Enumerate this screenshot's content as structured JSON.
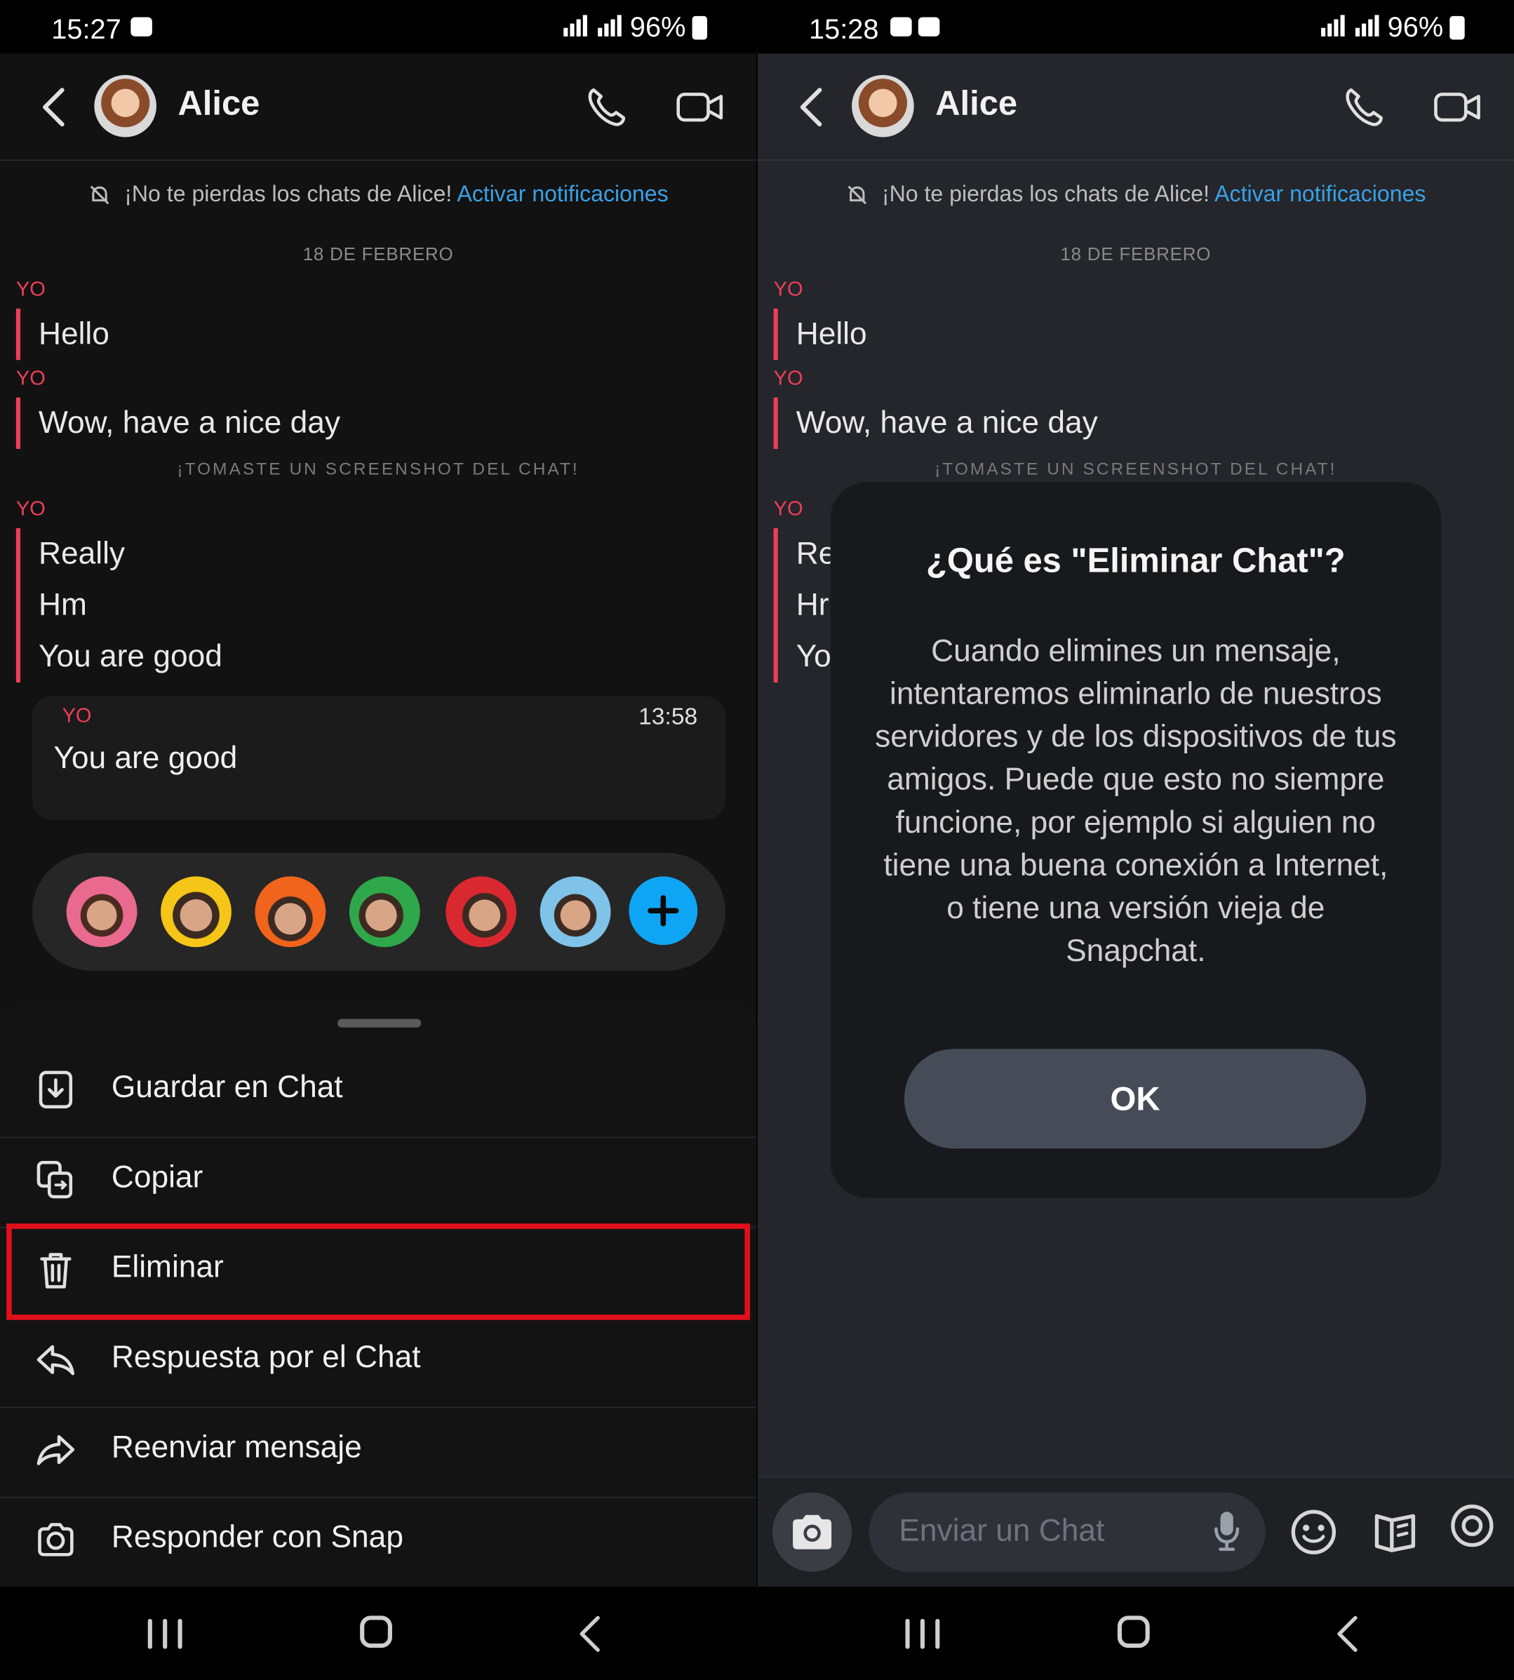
{
  "left": {
    "status": {
      "time": "15:27",
      "battery": "96%"
    },
    "header": {
      "contact_name": "Alice"
    },
    "notify": {
      "text": "¡No te pierdas los chats de Alice!",
      "link": "Activar notificaciones"
    },
    "date_label": "18 DE FEBRERO",
    "sender": "YO",
    "messages_a": [
      "Hello"
    ],
    "messages_b": [
      "Wow, have a nice day"
    ],
    "screenshot_notice": "¡TOMASTE UN SCREENSHOT DEL CHAT!",
    "messages_c": [
      "Really",
      "Hm",
      "You are good"
    ],
    "selected": {
      "sender": "YO",
      "time": "13:58",
      "text": "You are good"
    },
    "menu": [
      {
        "label": "Guardar en Chat",
        "icon": "save-in-chat-icon"
      },
      {
        "label": "Copiar",
        "icon": "copy-icon"
      },
      {
        "label": "Eliminar",
        "icon": "trash-icon"
      },
      {
        "label": "Respuesta por el Chat",
        "icon": "reply-icon"
      },
      {
        "label": "Reenviar mensaje",
        "icon": "forward-icon"
      },
      {
        "label": "Responder con Snap",
        "icon": "camera-icon"
      }
    ],
    "highlighted_item": "Eliminar"
  },
  "right": {
    "status": {
      "time": "15:28",
      "battery": "96%"
    },
    "header": {
      "contact_name": "Alice"
    },
    "notify": {
      "text": "¡No te pierdas los chats de Alice!",
      "link": "Activar notificaciones"
    },
    "date_label": "18 DE FEBRERO",
    "sender": "YO",
    "messages_a": [
      "Hello"
    ],
    "messages_b": [
      "Wow, have a nice day"
    ],
    "screenshot_notice": "¡TOMASTE UN SCREENSHOT DEL CHAT!",
    "messages_c_partial": [
      "Re",
      "Hr",
      "Yo"
    ],
    "modal": {
      "title": "¿Qué es \"Eliminar Chat\"?",
      "body": "Cuando elimines un mensaje, intentaremos eliminarlo de nuestros servidores y de los dispositivos de tus amigos. Puede que esto no siempre funcione, por ejemplo si alguien no tiene una buena conexión a Internet, o tiene una versión vieja de Snapchat.",
      "ok_label": "OK"
    },
    "composer": {
      "placeholder": "Enviar un Chat"
    }
  },
  "colors": {
    "accent_red": "#ef3e59",
    "link_blue": "#3aa1e6",
    "plus_blue": "#0ea5f5",
    "highlight_red": "#e0101a"
  }
}
